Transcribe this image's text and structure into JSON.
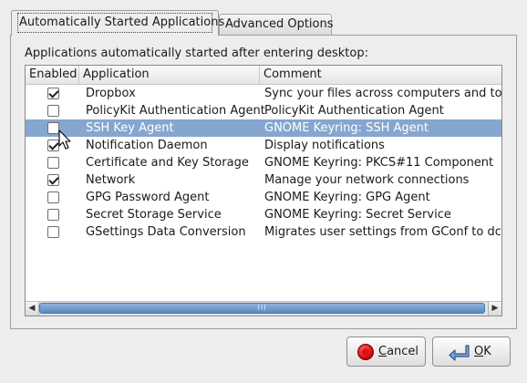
{
  "tabs": [
    {
      "label": "Automatically Started Applications",
      "active": true
    },
    {
      "label": "Advanced Options",
      "active": false
    }
  ],
  "section_label": "Applications automatically started after entering desktop:",
  "columns": [
    "Enabled",
    "Application",
    "Comment"
  ],
  "rows": [
    {
      "enabled": true,
      "application": "Dropbox",
      "comment": "Sync your files across computers and to th",
      "selected": false
    },
    {
      "enabled": false,
      "application": "PolicyKit Authentication Agent",
      "comment": "PolicyKit Authentication Agent",
      "selected": false
    },
    {
      "enabled": false,
      "application": "SSH Key Agent",
      "comment": "GNOME Keyring: SSH Agent",
      "selected": true
    },
    {
      "enabled": true,
      "application": "Notification Daemon",
      "comment": "Display notifications",
      "selected": false
    },
    {
      "enabled": false,
      "application": "Certificate and Key Storage",
      "comment": "GNOME Keyring: PKCS#11 Component",
      "selected": false
    },
    {
      "enabled": true,
      "application": "Network",
      "comment": "Manage your network connections",
      "selected": false
    },
    {
      "enabled": false,
      "application": "GPG Password Agent",
      "comment": "GNOME Keyring: GPG Agent",
      "selected": false
    },
    {
      "enabled": false,
      "application": "Secret Storage Service",
      "comment": "GNOME Keyring: Secret Service",
      "selected": false
    },
    {
      "enabled": false,
      "application": "GSettings Data Conversion",
      "comment": "Migrates user settings from GConf to dcor",
      "selected": false
    }
  ],
  "scrollbar": {
    "thumb_grip": "III"
  },
  "buttons": {
    "cancel": {
      "label": "Cancel",
      "mnemonic": "C",
      "rest": "ancel",
      "icon": "stop-icon"
    },
    "ok": {
      "label": "OK",
      "mnemonic": "O",
      "rest": "K",
      "icon": "return-arrow-icon"
    }
  },
  "colors": {
    "selection": "#85a6cf",
    "scroll_thumb": "#5b89c0"
  }
}
